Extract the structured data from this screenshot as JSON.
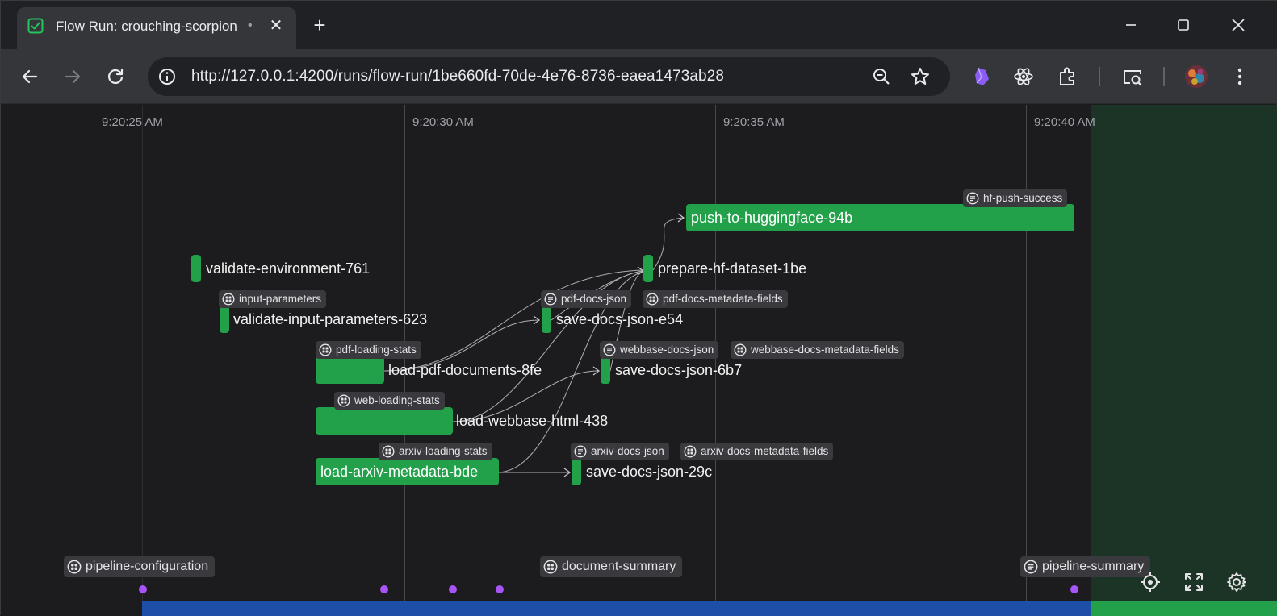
{
  "browser": {
    "tab": {
      "title": "Flow Run: crouching-scorpion",
      "favicon": "checkbox-icon",
      "close": "✕"
    },
    "new_tab": "+",
    "url": "http://127.0.0.1:4200/runs/flow-run/1be660fd-70de-4e76-8736-eaea1473ab28",
    "window_controls": [
      "minimize",
      "maximize",
      "close"
    ],
    "toolbar_icons": [
      "back-icon",
      "forward-icon",
      "reload-icon",
      "site-info-icon",
      "zoom-icon",
      "bookmark-star-icon",
      "obsidian-extension-icon",
      "react-extension-icon",
      "extensions-icon",
      "media-search-icon",
      "profile-avatar",
      "menu-icon"
    ]
  },
  "timeline": {
    "time_labels": [
      "9:20:25 AM",
      "9:20:30 AM",
      "9:20:35 AM",
      "9:20:40 AM"
    ],
    "colors": {
      "completed": "#22a04a",
      "background": "#1c1c1e",
      "future_region": "#1c3426",
      "event": "#a855f7",
      "progress": "#1d4fa8"
    }
  },
  "task_runs": {
    "push_to_huggingface": "push-to-huggingface-94b",
    "validate_environment": "validate-environment-761",
    "prepare_hf_dataset": "prepare-hf-dataset-1be",
    "validate_input_parameters": "validate-input-parameters-623",
    "save_docs_json_e54": "save-docs-json-e54",
    "load_pdf_documents": "load-pdf-documents-8fe",
    "save_docs_json_6b7": "save-docs-json-6b7",
    "load_webbase_html": "load-webbase-html-438",
    "load_arxiv_metadata": "load-arxiv-metadata-bde",
    "save_docs_json_29c": "save-docs-json-29c"
  },
  "artifacts": {
    "hf_push_success": {
      "label": "hf-push-success",
      "icon": "markdown-icon"
    },
    "input_parameters": {
      "label": "input-parameters",
      "icon": "table-icon"
    },
    "pdf_docs_json": {
      "label": "pdf-docs-json",
      "icon": "markdown-icon"
    },
    "pdf_docs_metadata_fields": {
      "label": "pdf-docs-metadata-fields",
      "icon": "table-icon"
    },
    "pdf_loading_stats": {
      "label": "pdf-loading-stats",
      "icon": "table-icon"
    },
    "webbase_docs_json": {
      "label": "webbase-docs-json",
      "icon": "markdown-icon"
    },
    "webbase_docs_metadata_fields": {
      "label": "webbase-docs-metadata-fields",
      "icon": "table-icon"
    },
    "web_loading_stats": {
      "label": "web-loading-stats",
      "icon": "table-icon"
    },
    "arxiv_loading_stats": {
      "label": "arxiv-loading-stats",
      "icon": "table-icon"
    },
    "arxiv_docs_json": {
      "label": "arxiv-docs-json",
      "icon": "markdown-icon"
    },
    "arxiv_docs_metadata_fields": {
      "label": "arxiv-docs-metadata-fields",
      "icon": "table-icon"
    },
    "pipeline_configuration": {
      "label": "pipeline-configuration",
      "icon": "table-icon"
    },
    "document_summary": {
      "label": "document-summary",
      "icon": "table-icon"
    },
    "pipeline_summary": {
      "label": "pipeline-summary",
      "icon": "markdown-icon"
    }
  },
  "controls": [
    "recenter-icon",
    "fullscreen-icon",
    "settings-icon"
  ]
}
